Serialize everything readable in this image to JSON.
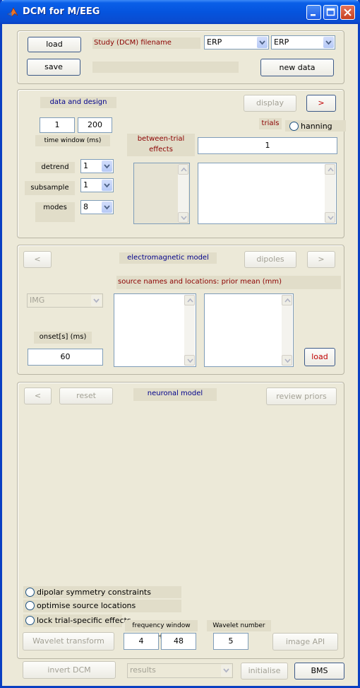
{
  "window": {
    "title": "DCM for M/EEG"
  },
  "top": {
    "load_label": "load",
    "save_label": "save",
    "filename_label": "Study (DCM) filename",
    "filename_value": "",
    "model_select_1": "ERP",
    "model_select_2": "ERP",
    "new_data_label": "new data"
  },
  "data_design": {
    "header": "data and design",
    "display_label": "display",
    "next_label": ">",
    "time_start": "1",
    "time_end": "200",
    "time_window_label": "time window (ms)",
    "trials_label": "trials",
    "hanning_label": "hanning",
    "between_trial_label_1": "between-trial",
    "between_trial_label_2": "effects",
    "trials_value": "1",
    "detrend_label": "detrend",
    "detrend_value": "1",
    "subsample_label": "subsample",
    "subsample_value": "1",
    "modes_label": "modes",
    "modes_value": "8"
  },
  "em_model": {
    "prev_label": "<",
    "header": "electromagnetic model",
    "dipoles_label": "dipoles",
    "next_label": ">",
    "source_label": "source names and locations: prior mean (mm)",
    "type_select": "IMG",
    "onset_label": "onset[s] (ms)",
    "onset_value": "60",
    "load_label": "load"
  },
  "neuronal": {
    "prev_label": "<",
    "reset_label": "reset",
    "header": "neuronal model",
    "review_priors_label": "review priors",
    "opt_dipolar": "dipolar symmetry constraints",
    "opt_optimise": "optimise source locations",
    "opt_lock": "lock trial-specific effects",
    "freq_window_label": "frequency window (Hz)",
    "wavelet_number_label": "Wavelet number",
    "wavelet_transform_label": "Wavelet transform",
    "freq_low": "4",
    "freq_high": "48",
    "wavelet_number": "5",
    "image_api_label": "image API"
  },
  "bottom": {
    "invert_label": "invert DCM",
    "results_select": "results",
    "initialise_label": "initialise",
    "bms_label": "BMS"
  },
  "colors": {
    "title_blue": "#0554de",
    "panel_bg": "#ece9d8",
    "label_red": "#8b0000",
    "label_blue": "#00008b"
  }
}
